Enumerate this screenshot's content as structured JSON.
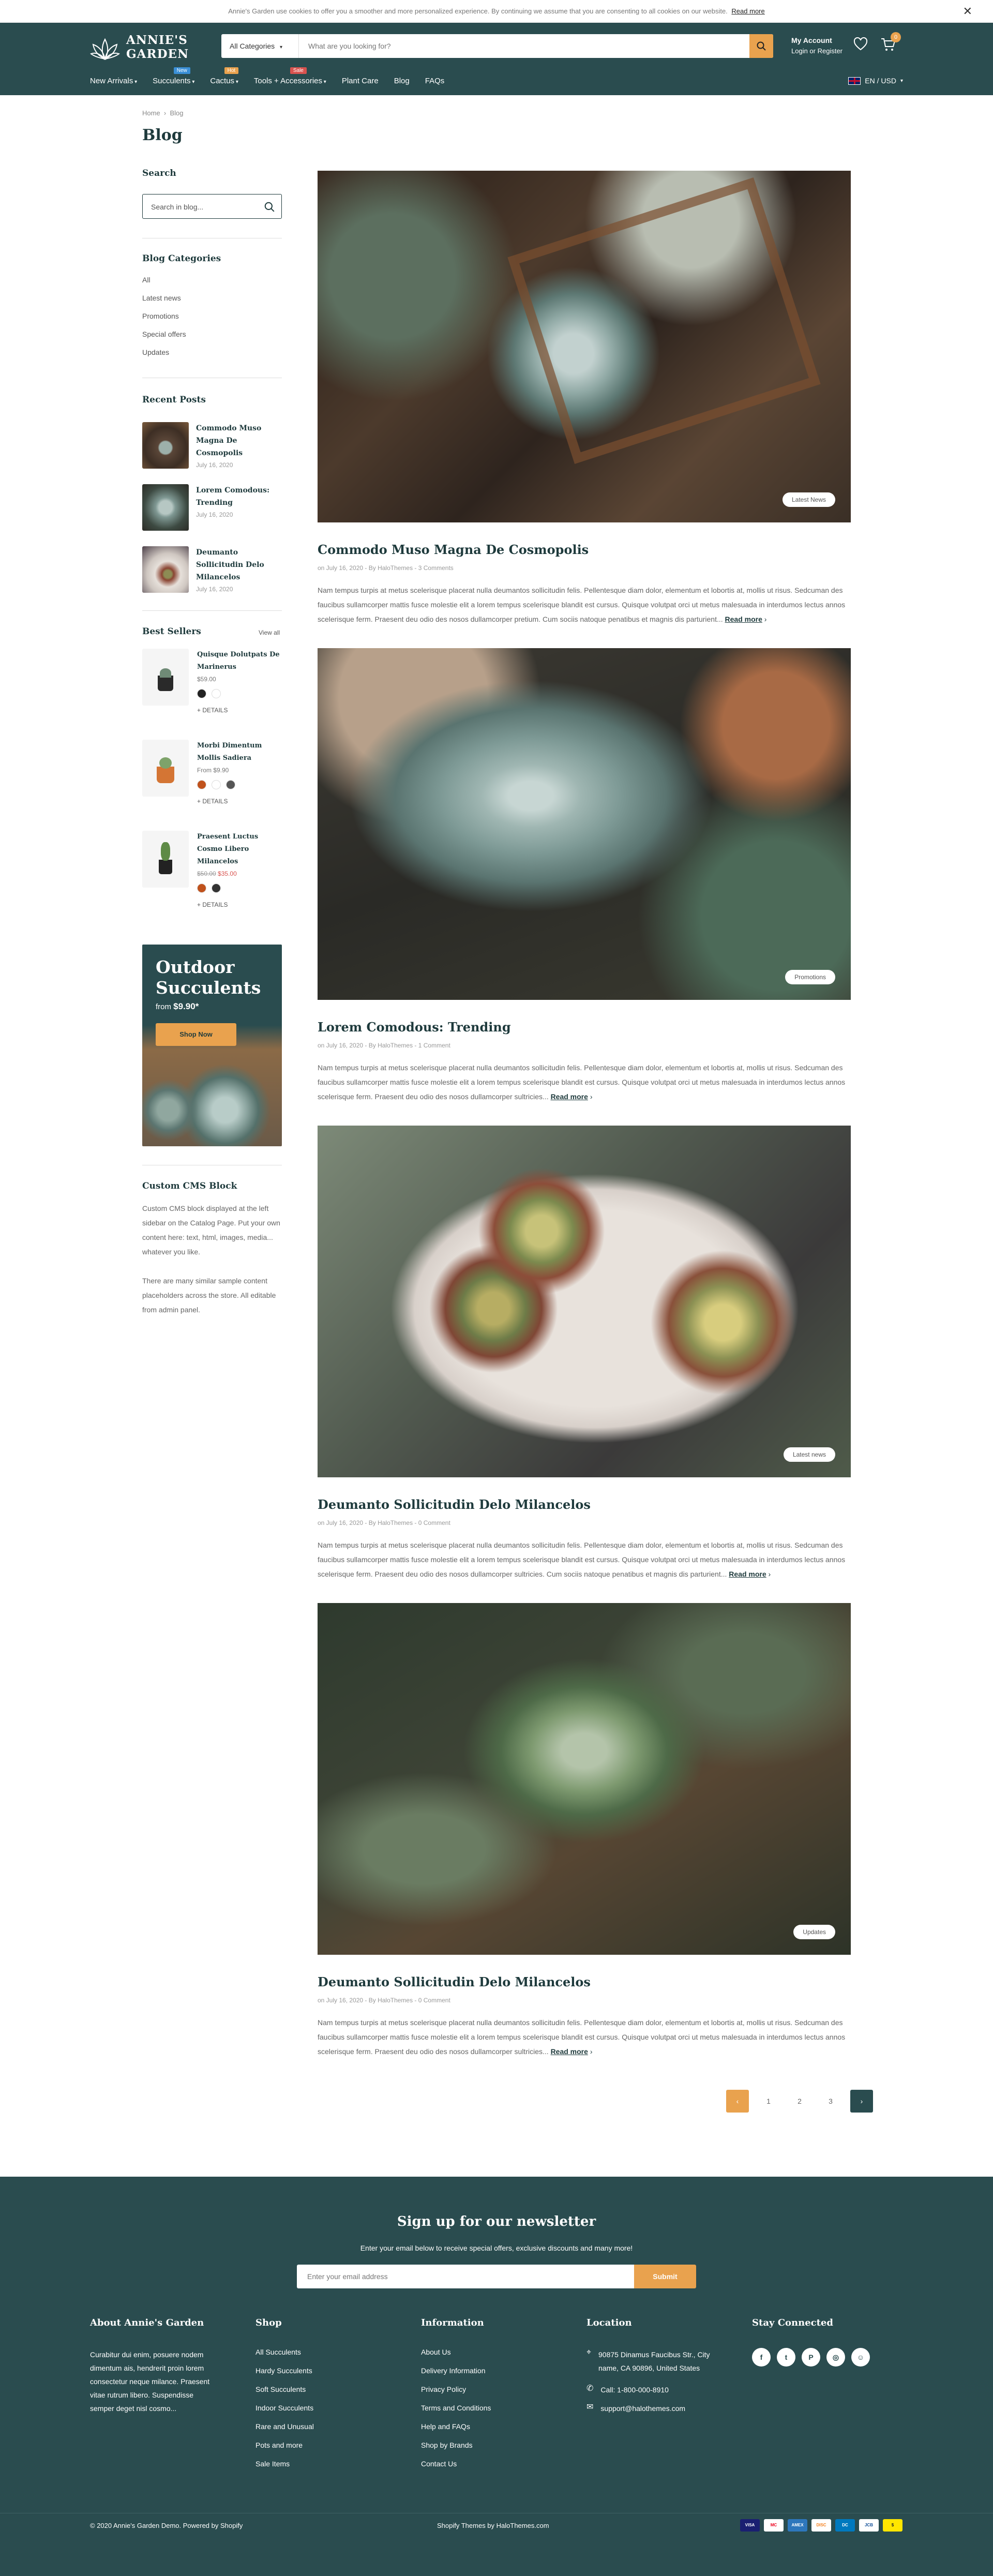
{
  "cookie": {
    "text": "Annie's Garden use cookies to offer you a smoother and more personalized experience. By continuing we assume that you are consenting to all cookies on our website.",
    "link": "Read more"
  },
  "header": {
    "logo_line1": "ANNIE'S",
    "logo_line2": "GARDEN",
    "category": "All Categories",
    "search_placeholder": "What are you looking for?",
    "account_title": "My Account",
    "account_sub": "Login or Register",
    "cart_count": "0",
    "language": "EN / USD"
  },
  "nav": [
    {
      "label": "New Arrivals",
      "tag": "",
      "tag_color": ""
    },
    {
      "label": "Succulents",
      "tag": "New",
      "tag_color": "#3a8fd6"
    },
    {
      "label": "Cactus",
      "tag": "Hot",
      "tag_color": "#e9a24e"
    },
    {
      "label": "Tools + Accessories",
      "tag": "Sale",
      "tag_color": "#d9534f"
    },
    {
      "label": "Plant Care",
      "tag": "",
      "tag_color": ""
    },
    {
      "label": "Blog",
      "tag": "",
      "tag_color": ""
    },
    {
      "label": "FAQs",
      "tag": "",
      "tag_color": ""
    }
  ],
  "breadcrumb": {
    "home": "Home",
    "current": "Blog"
  },
  "page_title": "Blog",
  "sidebar": {
    "search_title": "Search",
    "search_placeholder": "Search in blog...",
    "categories_title": "Blog Categories",
    "categories": [
      "All",
      "Latest news",
      "Promotions",
      "Special offers",
      "Updates"
    ],
    "recent_title": "Recent Posts",
    "recent": [
      {
        "title": "Commodo Muso Magna De Cosmopolis",
        "date": "July 16, 2020"
      },
      {
        "title": "Lorem Comodous: Trending",
        "date": "July 16, 2020"
      },
      {
        "title": "Deumanto Sollicitudin Delo Milancelos",
        "date": "July 16, 2020"
      }
    ],
    "best_title": "Best Sellers",
    "view_all": "View all",
    "best": [
      {
        "title": "Quisque Dolutpats De Marinerus",
        "price": "$59.00",
        "old": "",
        "details": "+ DETAILS",
        "swatches": [
          "#222222",
          "#ffffff"
        ]
      },
      {
        "title": "Morbi Dimentum Mollis Sadiera",
        "price": "From $9.90",
        "old": "",
        "details": "+ DETAILS",
        "swatches": [
          "#c0521c",
          "#ffffff",
          "#555555"
        ]
      },
      {
        "title": "Praesent Luctus Cosmo Libero Milancelos",
        "price": "$50.00",
        "old": "$35.00",
        "details": "+ DETAILS",
        "swatches": [
          "#c0521c",
          "#333333"
        ]
      }
    ],
    "banner": {
      "line1": "Outdoor",
      "line2": "Succulents",
      "from": "from",
      "price": "$9.90*",
      "button": "Shop Now"
    },
    "cms_title": "Custom CMS Block",
    "cms_p1": "Custom CMS block displayed at the left sidebar on the Catalog Page. Put your own content here: text, html, images, media... whatever you like.",
    "cms_p2": "There are many similar sample content placeholders across the store. All editable from admin panel."
  },
  "posts": [
    {
      "title": "Commodo Muso Magna De Cosmopolis",
      "meta": "on July 16, 2020 - By HaloThemes - 3 Comments",
      "tag": "Latest News",
      "excerpt": "Nam tempus turpis at metus scelerisque placerat nulla deumantos sollicitudin felis. Pellentesque diam dolor, elementum et lobortis at, mollis ut risus. Sedcuman des faucibus sullamcorper mattis fusce molestie elit a lorem tempus scelerisque blandit est cursus. Quisque volutpat orci ut metus malesuada in interdumos lectus annos scelerisque ferm. Praesent deu odio des nosos dullamcorper pretium. Cum sociis natoque penatibus et magnis dis parturient...",
      "read": "Read more"
    },
    {
      "title": "Lorem Comodous: Trending",
      "meta": "on July 16, 2020 - By HaloThemes - 1 Comment",
      "tag": "Promotions",
      "excerpt": "Nam tempus turpis at metus scelerisque placerat nulla deumantos sollicitudin felis. Pellentesque diam dolor, elementum et lobortis at, mollis ut risus. Sedcuman des faucibus sullamcorper mattis fusce molestie elit a lorem tempus scelerisque blandit est cursus. Quisque volutpat orci ut metus malesuada in interdumos lectus annos scelerisque ferm. Praesent deu odio des nosos dullamcorper sultricies...",
      "read": "Read more"
    },
    {
      "title": "Deumanto Sollicitudin Delo Milancelos",
      "meta": "on July 16, 2020 - By HaloThemes - 0 Comment",
      "tag": "Latest news",
      "excerpt": "Nam tempus turpis at metus scelerisque placerat nulla deumantos sollicitudin felis. Pellentesque diam dolor, elementum et lobortis at, mollis ut risus. Sedcuman des faucibus sullamcorper mattis fusce molestie elit a lorem tempus scelerisque blandit est cursus. Quisque volutpat orci ut metus malesuada in interdumos lectus annos scelerisque ferm. Praesent deu odio des nosos dullamcorper sultricies. Cum sociis natoque penatibus et magnis dis parturient...",
      "read": "Read more"
    },
    {
      "title": "Deumanto Sollicitudin Delo Milancelos",
      "meta": "on July 16, 2020 - By HaloThemes - 0 Comment",
      "tag": "Updates",
      "excerpt": "Nam tempus turpis at metus scelerisque placerat nulla deumantos sollicitudin felis. Pellentesque diam dolor, elementum et lobortis at, mollis ut risus. Sedcuman des faucibus sullamcorper mattis fusce molestie elit a lorem tempus scelerisque blandit est cursus. Quisque volutpat orci ut metus malesuada in interdumos lectus annos scelerisque ferm. Praesent deu odio des nosos dullamcorper sultricies...",
      "read": "Read more"
    }
  ],
  "pagination": [
    "1",
    "2",
    "3"
  ],
  "footer": {
    "nl_title": "Sign up for our newsletter",
    "nl_sub": "Enter your email below to receive special offers, exclusive discounts and many more!",
    "nl_placeholder": "Enter your email address",
    "nl_button": "Submit",
    "about_title": "About Annie's Garden",
    "about_text": "Curabitur dui enim, posuere nodem dimentum ais, hendrerit proin lorem consectetur neque milance. Praesent vitae rutrum libero. Suspendisse semper deget nisl cosmo...",
    "shop_title": "Shop",
    "shop": [
      "All Succulents",
      "Hardy Succulents",
      "Soft Succulents",
      "Indoor Succulents",
      "Rare and Unusual",
      "Pots and more",
      "Sale Items"
    ],
    "info_title": "Information",
    "info": [
      "About Us",
      "Delivery Information",
      "Privacy Policy",
      "Terms and Conditions",
      "Help and FAQs",
      "Shop by Brands",
      "Contact Us"
    ],
    "loc_title": "Location",
    "address": "90875 Dinamus Faucibus Str., City name, CA 90896, United States",
    "phone": "Call: 1-800-000-8910",
    "email": "support@halothemes.com",
    "social_title": "Stay Connected",
    "copyright": "© 2020 Annie's Garden Demo. Powered by Shopify",
    "credit": "Shopify Themes by HaloThemes.com",
    "payments": [
      "VISA",
      "MC",
      "AMEX",
      "DISC",
      "DC",
      "JCB",
      "$"
    ]
  },
  "colors": {
    "primary": "#2a4c4f",
    "accent": "#e9a24e"
  }
}
